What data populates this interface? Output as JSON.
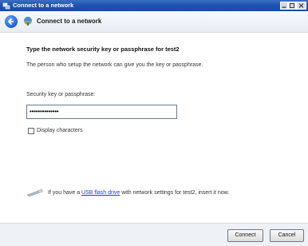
{
  "window": {
    "title": "Connect to a network",
    "minimize_icon": "minimize-icon",
    "maximize_icon": "maximize-icon",
    "close_icon": "close-icon"
  },
  "header": {
    "back_icon": "back-arrow-icon",
    "network_icon": "network-icon",
    "title": "Connect to a network"
  },
  "content": {
    "heading": "Type the network security key or passphrase for test2",
    "description": "The person who setup the network can give you the key or passphrase.",
    "key_label": "Security key or passphrase:",
    "key_value": "••••••••••••••",
    "show_chars_label": "Display characters",
    "show_chars_checked": false
  },
  "usb": {
    "icon": "usb-drive-icon",
    "prefix": "If you have a ",
    "link": "USB flash drive",
    "suffix": " with network settings for test2, insert it now."
  },
  "footer": {
    "connect_label": "Connect",
    "cancel_label": "Cancel"
  },
  "colors": {
    "titlebar": "#1f55b0",
    "link": "#1a3fd0"
  }
}
